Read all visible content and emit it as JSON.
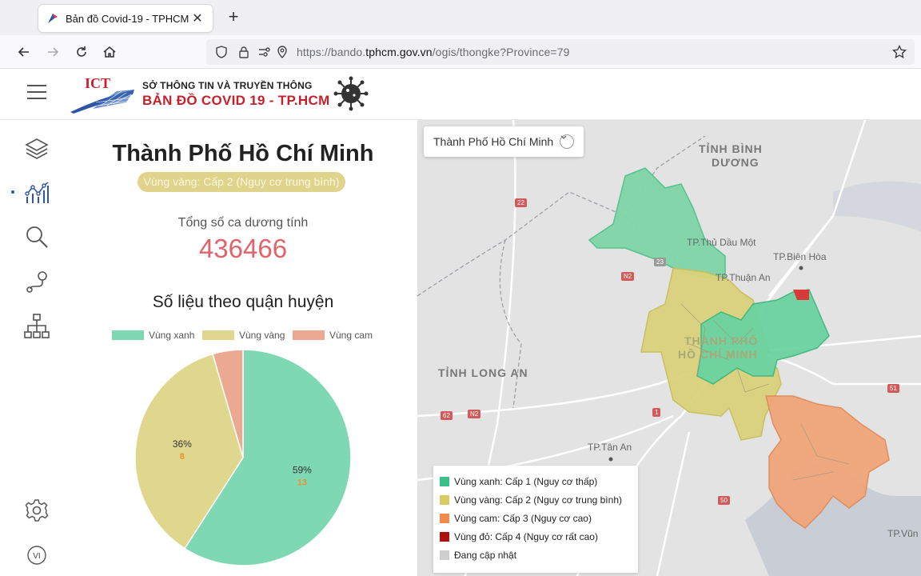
{
  "browser": {
    "tab_title": "Bản đồ Covid-19 - TPHCM",
    "url_prefix": "https://bando.",
    "url_domain": "tphcm.gov.vn",
    "url_path": "/ogis/thongke?Province=79"
  },
  "header": {
    "logo_text": "ICT",
    "org_name": "SỞ THÔNG TIN VÀ TRUYỀN THÔNG",
    "app_title": "BẢN ĐỒ  COVID 19 - TP.HCM"
  },
  "rail": {
    "icons": [
      "layers-icon",
      "chart-icon",
      "search-icon",
      "route-icon",
      "org-chart-icon",
      "settings-icon",
      "language-icon"
    ],
    "language": "VI"
  },
  "panel": {
    "city": "Thành Phố Hồ Chí Minh",
    "level": "Vùng vàng: Cấp 2 (Nguy cơ trung bình)",
    "total_label": "Tổng số ca dương tính",
    "total_value": "436466",
    "chart_title": "Số liệu theo quận huyện"
  },
  "chart_data": {
    "type": "pie",
    "title": "Số liệu theo quận huyện",
    "categories": [
      "Vùng xanh",
      "Vùng vàng",
      "Vùng cam"
    ],
    "counts": [
      13,
      8,
      1
    ],
    "percent_labels": [
      "59%",
      "36%",
      ""
    ],
    "count_labels": [
      "13",
      "8",
      ""
    ],
    "colors": [
      "#7fd8b4",
      "#e0d78f",
      "#eba991"
    ],
    "legend_position": "top"
  },
  "map": {
    "province_select": "Thành Phố Hồ Chí Minh",
    "labels": {
      "binh_duong_1": "TỈNH BÌNH",
      "binh_duong_2": "DƯƠNG",
      "thu_dau_mot": "TP.Thủ Dầu Một",
      "bien_hoa": "TP.Biên Hòa",
      "thuan_an": "TP.Thuận An",
      "hcm_1": "THÀNH PHỐ",
      "hcm_2": "HỒ CHÍ MINH",
      "long_an": "TỈNH LONG AN",
      "tan_an": "TP.Tân An",
      "vung_tau": "TP.Vũn"
    },
    "road_badges": [
      "22",
      "23",
      "N2",
      "1",
      "62",
      "N2",
      "51",
      "50"
    ],
    "legend": [
      {
        "label": "Vùng xanh: Cấp 1 (Nguy cơ thấp)",
        "color": "#3cc088"
      },
      {
        "label": "Vùng vàng: Cấp 2 (Nguy cơ trung bình)",
        "color": "#d8cc62"
      },
      {
        "label": "Vùng cam: Cấp 3 (Nguy cơ cao)",
        "color": "#f0894a"
      },
      {
        "label": "Vùng đỏ: Cấp 4 (Nguy cơ rất cao)",
        "color": "#b01010"
      },
      {
        "label": "Đang cập nhật",
        "color": "#cfcfcf"
      }
    ]
  }
}
